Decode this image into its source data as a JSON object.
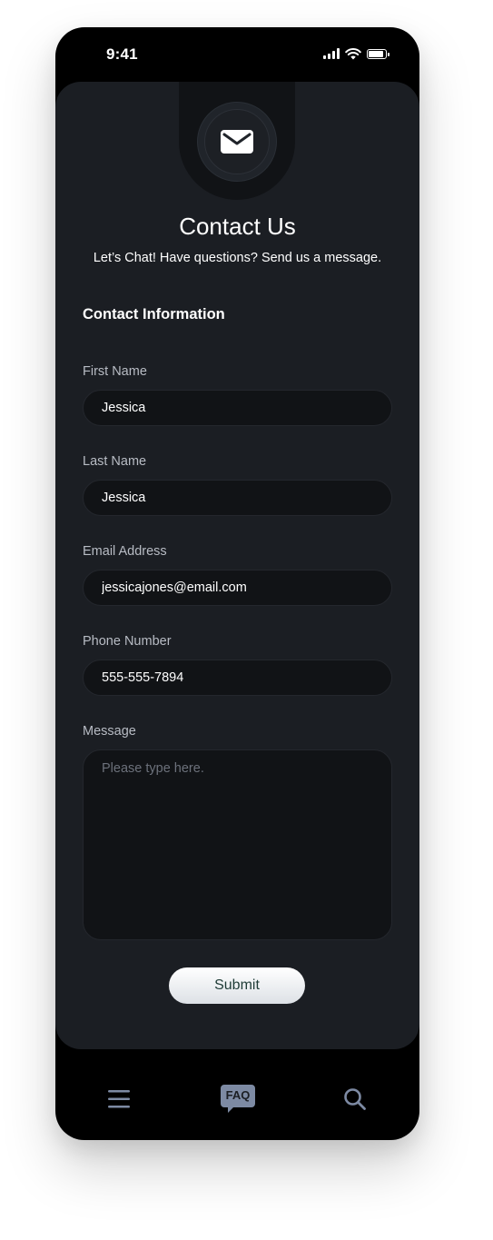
{
  "status_bar": {
    "time": "9:41"
  },
  "header": {
    "icon": "envelope-icon",
    "title": "Contact Us",
    "subtitle": "Let’s Chat! Have questions? Send us a message."
  },
  "form": {
    "section_title": "Contact Information",
    "fields": [
      {
        "label": "First Name",
        "value": "Jessica"
      },
      {
        "label": "Last Name",
        "value": "Jessica"
      },
      {
        "label": "Email Address",
        "value": "jessicajones@email.com"
      },
      {
        "label": "Phone Number",
        "value": "555-555-7894"
      }
    ],
    "message": {
      "label": "Message",
      "placeholder": "Please type here."
    },
    "submit_label": "Submit"
  },
  "tab_bar": {
    "items": [
      {
        "icon": "menu-icon",
        "active": false
      },
      {
        "icon": "faq-icon",
        "label": "FAQ",
        "active": true
      },
      {
        "icon": "search-icon",
        "active": false
      }
    ]
  },
  "colors": {
    "background": "#000000",
    "card": "#1b1e23",
    "input": "#111316",
    "accent": "#7d8aa3",
    "submit_text": "#1e3b36"
  }
}
